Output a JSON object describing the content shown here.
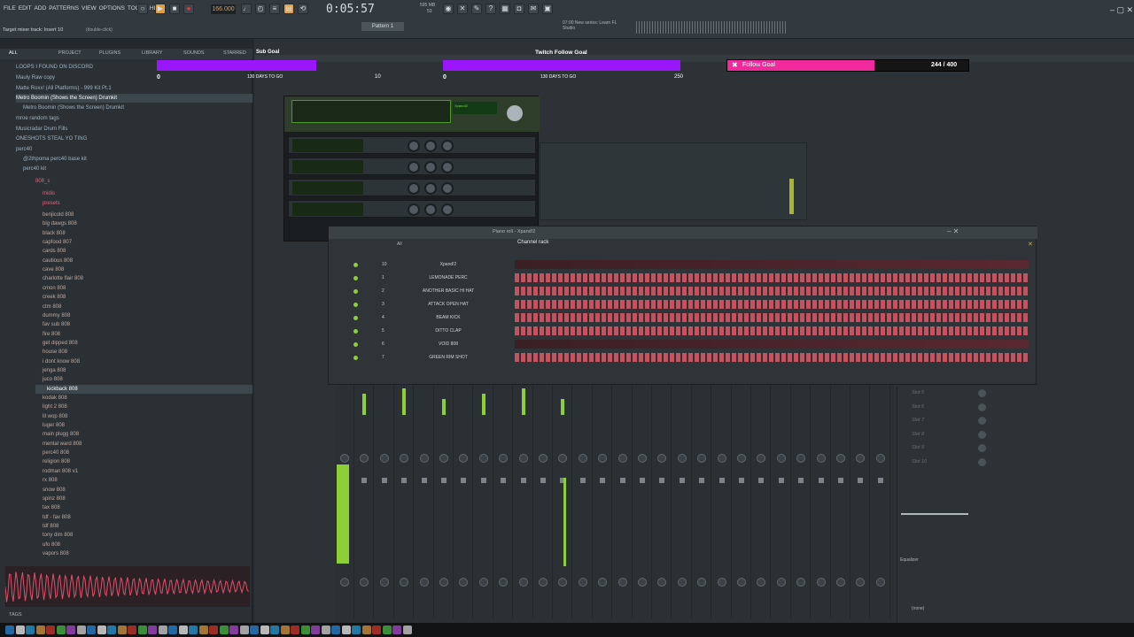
{
  "menu": [
    "FILE",
    "EDIT",
    "ADD",
    "PATTERNS",
    "VIEW",
    "OPTIONS",
    "TOOLS",
    "HELP"
  ],
  "transport": {
    "tempo": "166.000",
    "time": "0:05:57",
    "memory": "595 MB",
    "cpu": "53",
    "pattern": "Pattern 1"
  },
  "hint": {
    "target": "Target mixer track: Insert 10",
    "hint2": "(double-click)",
    "news": "07:00 New series: Learn FL Studio"
  },
  "browser": {
    "tabs": [
      "ALL",
      "PROJECT",
      "PLUGINS",
      "SOUNDS",
      "LIBRARY",
      "STARRED"
    ],
    "folders": [
      "LOOPS I FOUND ON DISCORD",
      "Mauly Raw copy",
      "Matte Roxx! (All Platforms) - 999 Kit Pt.1",
      "Metro Boomin (Shows the Screen) Drumkit",
      "Metro Boomin (Shows the Screen) Drumkit",
      "mroe random tags",
      "Musicradar Drum Fills",
      "ONESHOTS STEAL YO TING",
      "perc40",
      "@2thpoma perc40 base kit",
      "perc40 kit",
      "808_s",
      "midis",
      "presets"
    ],
    "files": [
      "benjicold 808",
      "big dawgs 808",
      "black 808",
      "capfood 807",
      "cards 808",
      "cautious 808",
      "cave 808",
      "charlotte flair 808",
      "cmon 808",
      "creek 808",
      "ctm 808",
      "dummy 808",
      "fav sub 808",
      "fire 808",
      "get dipped 808",
      "house 808",
      "i dont know 808",
      "jenga 808",
      "juco 808",
      "kickback 808",
      "kodak 808",
      "light 2 808",
      "lil wop 808",
      "luger 808",
      "main plugg 808",
      "mental ward 808",
      "perc40 808",
      "religion 808",
      "rodman 808 v1",
      "rx 808",
      "snow 808",
      "spinz 808",
      "tax 808",
      "tdf - fav 808",
      "tdf 808",
      "tony dim 808",
      "ufo 808",
      "vapors 808"
    ],
    "selected": "kickback 808",
    "tags_label": "TAGS"
  },
  "goals": {
    "sub_label": "Sub Goal",
    "sub_left": "0",
    "sub_right": "10",
    "sub_caption": "130 DAYS TO GO",
    "twitch_label": "Twitch Follow Goal",
    "twitch_left": "0",
    "twitch_right": "250",
    "twitch_caption": "130 DAYS TO GO",
    "follow_label": "Follow Goal",
    "follow_count": "244 / 400",
    "follow_progress": 0.61
  },
  "windows": {
    "xpand": "Xpand!2",
    "pianoroll": "Piano roll - Xpand!2",
    "channel_rack": "Channel rack",
    "channel_filter": "All"
  },
  "channels": [
    {
      "num": "10",
      "name": "Xpand!2"
    },
    {
      "num": "1",
      "name": "LEMONADE PERC"
    },
    {
      "num": "2",
      "name": "ANOTHER BASIC HI HAT"
    },
    {
      "num": "3",
      "name": "ATTACK OPEN HAT"
    },
    {
      "num": "4",
      "name": "BEAM KICK"
    },
    {
      "num": "5",
      "name": "DITTO CLAP"
    },
    {
      "num": "6",
      "name": "VOID 808"
    },
    {
      "num": "7",
      "name": "GREEN RIM SHOT"
    }
  ],
  "mixer": {
    "slots": [
      "Slot 5",
      "Slot 6",
      "Slot 7",
      "Slot 8",
      "Slot 9",
      "Slot 10"
    ],
    "eq_label": "Equalizer",
    "none": "(none)"
  },
  "colors": {
    "accent": "#8fcf36",
    "goal_purple": "#9a16ff",
    "goal_pink": "#f0299d",
    "step": "#c25460"
  }
}
